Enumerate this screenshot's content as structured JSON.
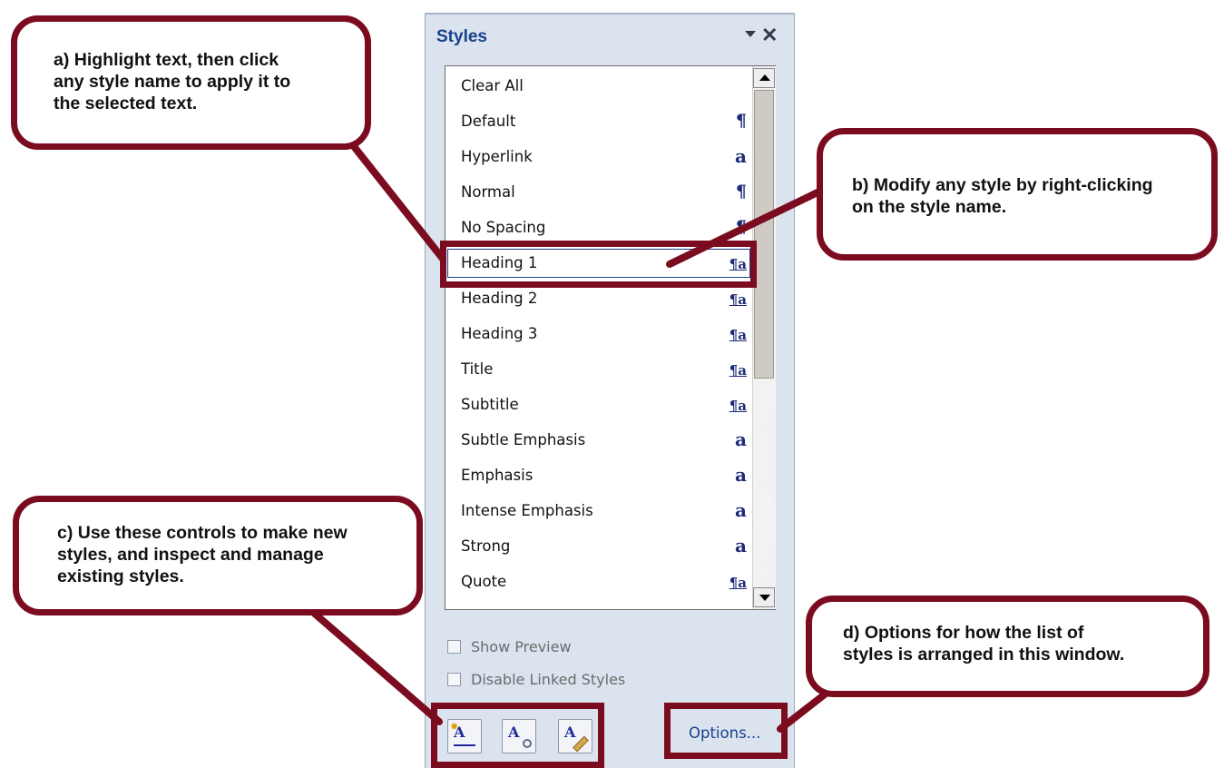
{
  "pane": {
    "title": "Styles",
    "close_glyph": "✕",
    "styles": [
      {
        "name": "Clear All",
        "icon": ""
      },
      {
        "name": "Default",
        "icon": "¶"
      },
      {
        "name": "Hyperlink",
        "icon": "a"
      },
      {
        "name": "Normal",
        "icon": "¶"
      },
      {
        "name": "No Spacing",
        "icon": "¶"
      },
      {
        "name": "Heading 1",
        "icon": "¶a"
      },
      {
        "name": "Heading 2",
        "icon": "¶a"
      },
      {
        "name": "Heading 3",
        "icon": "¶a"
      },
      {
        "name": "Title",
        "icon": "¶a"
      },
      {
        "name": "Subtitle",
        "icon": "¶a"
      },
      {
        "name": "Subtle Emphasis",
        "icon": "a"
      },
      {
        "name": "Emphasis",
        "icon": "a"
      },
      {
        "name": "Intense Emphasis",
        "icon": "a"
      },
      {
        "name": "Strong",
        "icon": "a"
      },
      {
        "name": "Quote",
        "icon": "¶a"
      }
    ],
    "selected_style": "Heading 1",
    "show_preview_label": "Show Preview",
    "disable_linked_label": "Disable Linked Styles",
    "options_label": "Options...",
    "new_style_glyph": "A",
    "inspect_glyph": "A",
    "manage_glyph": "A"
  },
  "callouts": {
    "a": [
      "a) Highlight text, then click",
      "any style name to apply it to",
      "the selected text."
    ],
    "b": [
      "b) Modify any style by right-clicking",
      "on the style name."
    ],
    "c": [
      "c) Use these controls to make new",
      "styles, and inspect and manage",
      "existing styles."
    ],
    "d": [
      "d) Options for how the list of",
      "styles is arranged in this window."
    ]
  },
  "colors": {
    "annotation": "#7b0c1f",
    "icon_blue": "#1f2a78",
    "pane_bg": "#dbe3ee",
    "title_blue": "#15428b"
  }
}
